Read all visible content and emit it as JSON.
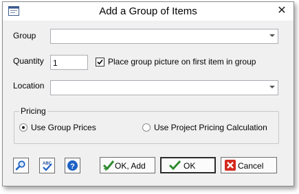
{
  "window": {
    "title": "Add a Group of Items",
    "close_glyph": "✕",
    "app_icon": "window-icon"
  },
  "form": {
    "group_label": "Group",
    "group_value": "",
    "quantity_label": "Quantity",
    "quantity_value": "1",
    "place_picture_label": "Place group picture on first item in group",
    "place_picture_checked": true,
    "location_label": "Location",
    "location_value": ""
  },
  "pricing": {
    "legend": "Pricing",
    "options": [
      {
        "label": "Use Group Prices",
        "selected": true
      },
      {
        "label": "Use Project Pricing Calculation",
        "selected": false
      }
    ]
  },
  "toolbar": {
    "search_icon": "magnifier-icon",
    "spellcheck_icon": "spellcheck-icon",
    "help_icon": "help-icon"
  },
  "buttons": {
    "ok_add": "OK, Add",
    "ok": "OK",
    "cancel": "Cancel"
  },
  "colors": {
    "check_green": "#2e8b2e",
    "cancel_red": "#d42a1e",
    "help_blue": "#1e62c4"
  }
}
